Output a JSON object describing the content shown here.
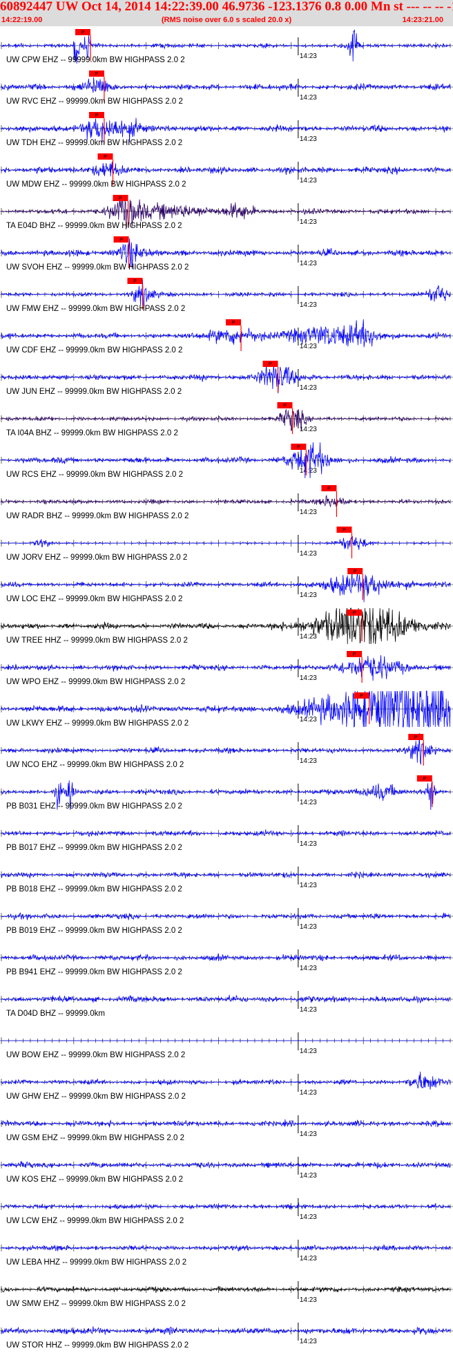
{
  "header": {
    "title": "60892447 UW Oct 14, 2014 14:22:39.00   46.9736 -123.1376  0.8 0.00 Mn st --- -- --   -1",
    "start_time": "14:22:19.00",
    "end_time": "14:23:21.00",
    "noise_note": "(RMS noise over 6.0 s scaled 20.0 x)"
  },
  "chart_data": {
    "type": "line",
    "x_unit": "seconds after 14:22:19.00",
    "xlim": [
      0,
      62
    ],
    "minute_tick_label": "14:23",
    "minute_tick_x": 41,
    "pick_label": "P",
    "colors": {
      "blue": "#0000ff",
      "purple": "#2a0066",
      "black": "#000000",
      "pick": "#ff0000"
    },
    "traces": [
      {
        "label": "UW CPW EHZ -- 99999.0km BW  HIGHPASS  2.0  2",
        "color": "blue",
        "amp": 0.35,
        "pick": 10.3,
        "events": [
          {
            "t": 10.4,
            "a": 4.2,
            "d": 0.3
          },
          {
            "t": 11.9,
            "a": 2.0,
            "d": 0.3
          },
          {
            "t": 48.6,
            "a": 3.6,
            "d": 0.4
          }
        ]
      },
      {
        "label": "UW RVC EHZ -- 99999.0km BW  HIGHPASS  2.0  2",
        "color": "blue",
        "amp": 0.5,
        "pick": 12.2,
        "events": [
          {
            "t": 13.0,
            "a": 1.5,
            "d": 1.2
          }
        ]
      },
      {
        "label": "UW TDH EHZ -- 99999.0km BW  HIGHPASS  2.0  2",
        "color": "blue",
        "amp": 0.55,
        "pick": 12.2,
        "events": [
          {
            "t": 13.8,
            "a": 1.6,
            "d": 2.0
          },
          {
            "t": 17.8,
            "a": 0.9,
            "d": 2.0
          }
        ]
      },
      {
        "label": "UW MDW EHZ -- 99999.0km BW  HIGHPASS  2.0  2",
        "color": "blue",
        "amp": 0.55,
        "pick": 13.4,
        "events": [
          {
            "t": 14.3,
            "a": 1.1,
            "d": 1.5
          }
        ]
      },
      {
        "label": "TA E04D BHZ -- 99999.0km BW  HIGHPASS  2.0  2",
        "color": "purple",
        "amp": 0.45,
        "pick": 15.5,
        "events": [
          {
            "t": 17.2,
            "a": 2.6,
            "d": 1.6
          },
          {
            "t": 24.0,
            "a": 1.1,
            "d": 3.0
          },
          {
            "t": 33.0,
            "a": 1.1,
            "d": 1.5
          }
        ]
      },
      {
        "label": "UW SVOH EHZ -- 99999.0km BW  HIGHPASS  2.0  2",
        "color": "blue",
        "amp": 0.55,
        "pick": 15.6,
        "events": [
          {
            "t": 17.7,
            "a": 2.2,
            "d": 1.0
          }
        ]
      },
      {
        "label": "UW FMW EHZ -- 99999.0km BW  HIGHPASS  2.0  2",
        "color": "blue",
        "amp": 0.35,
        "pick": 17.5,
        "events": [
          {
            "t": 19.6,
            "a": 1.8,
            "d": 1.0
          },
          {
            "t": 60.3,
            "a": 1.6,
            "d": 1.0
          }
        ]
      },
      {
        "label": "UW CDF EHZ -- 99999.0km BW  HIGHPASS  2.0  2",
        "color": "blue",
        "amp": 0.45,
        "pick": 31.1,
        "events": [
          {
            "t": 32.0,
            "a": 1.3,
            "d": 2.5
          },
          {
            "t": 44.0,
            "a": 1.6,
            "d": 3.0
          },
          {
            "t": 50.0,
            "a": 1.6,
            "d": 2.0
          }
        ]
      },
      {
        "label": "UW JUN EHZ -- 99999.0km BW  HIGHPASS  2.0  2",
        "color": "blue",
        "amp": 0.5,
        "pick": 36.2,
        "events": [
          {
            "t": 38.0,
            "a": 2.2,
            "d": 1.8
          }
        ]
      },
      {
        "label": "TA I04A BHZ -- 99999.0km BW  HIGHPASS  2.0  2",
        "color": "purple",
        "amp": 0.35,
        "pick": 38.2,
        "events": [
          {
            "t": 40.2,
            "a": 1.8,
            "d": 1.2
          }
        ]
      },
      {
        "label": "UW RCS EHZ -- 99999.0km BW  HIGHPASS  2.0  2",
        "color": "blue",
        "amp": 0.5,
        "pick": 40.1,
        "events": [
          {
            "t": 42.5,
            "a": 3.0,
            "d": 1.8
          }
        ]
      },
      {
        "label": "UW RADR BHZ -- 99999.0km BW  HIGHPASS  2.0  2",
        "color": "purple",
        "amp": 0.35,
        "pick": 44.3,
        "events": [
          {
            "t": 45.8,
            "a": 0.8,
            "d": 1.5
          }
        ]
      },
      {
        "label": "UW JORV EHZ -- 99999.0km BW  HIGHPASS  2.0  2",
        "color": "blue",
        "amp": 0.12,
        "pick": 46.4,
        "events": [
          {
            "t": 5.6,
            "a": 0.8,
            "d": 0.8
          },
          {
            "t": 48.5,
            "a": 1.4,
            "d": 1.5
          }
        ]
      },
      {
        "label": "UW LOC EHZ -- 99999.0km BW  HIGHPASS  2.0  2",
        "color": "blue",
        "amp": 0.4,
        "pick": 47.9,
        "events": [
          {
            "t": 49.5,
            "a": 1.8,
            "d": 3.5
          }
        ]
      },
      {
        "label": "UW TREE HHZ -- 99999.0km BW  HIGHPASS  2.0  2",
        "color": "black",
        "amp": 0.5,
        "pick": 47.8,
        "events": [
          {
            "t": 50.0,
            "a": 4.0,
            "d": 4.5
          }
        ]
      },
      {
        "label": "UW WPO EHZ -- 99999.0km BW  HIGHPASS  2.0  2",
        "color": "blue",
        "amp": 0.45,
        "pick": 47.8,
        "events": [
          {
            "t": 51.0,
            "a": 1.9,
            "d": 3.0
          }
        ]
      },
      {
        "label": "UW LKWY EHZ -- 99999.0km BW  HIGHPASS  2.0  2",
        "color": "blue",
        "amp": 0.6,
        "pick": 48.8,
        "events": [
          {
            "t": 52.5,
            "a": 4.2,
            "d": 6.0
          }
        ],
        "clip_from": 51.8
      },
      {
        "label": "UW NCO EHZ -- 99999.0km BW  HIGHPASS  2.0  2",
        "color": "blue",
        "amp": 0.45,
        "pick": 56.3,
        "events": [
          {
            "t": 58.0,
            "a": 2.0,
            "d": 1.0
          }
        ]
      },
      {
        "label": "PB B031 EHZ -- 99999.0km BW  HIGHPASS  2.0  2",
        "color": "blue",
        "amp": 0.45,
        "pick": 57.5,
        "events": [
          {
            "t": 7.9,
            "a": 2.4,
            "d": 0.3
          },
          {
            "t": 9.5,
            "a": 2.8,
            "d": 0.3
          },
          {
            "t": 52.3,
            "a": 1.3,
            "d": 1.5
          },
          {
            "t": 59.4,
            "a": 2.6,
            "d": 0.4
          }
        ]
      },
      {
        "label": "PB B017 EHZ -- 99999.0km BW  HIGHPASS  2.0  2",
        "color": "blue",
        "amp": 0.45,
        "events": []
      },
      {
        "label": "PB B018 EHZ -- 99999.0km BW  HIGHPASS  2.0  2",
        "color": "blue",
        "amp": 0.45,
        "events": []
      },
      {
        "label": "PB B019 EHZ -- 99999.0km BW  HIGHPASS  2.0  2",
        "color": "blue",
        "amp": 0.45,
        "events": []
      },
      {
        "label": "PB B941 EHZ -- 99999.0km BW  HIGHPASS  2.0  2",
        "color": "blue",
        "amp": 0.5,
        "events": []
      },
      {
        "label": "TA D04D BHZ -- 99999.0km",
        "color": "blue",
        "amp": 0.55,
        "events": []
      },
      {
        "label": "UW BOW EHZ -- 99999.0km BW  HIGHPASS  2.0  2",
        "color": "blue",
        "amp": 0.0,
        "events": []
      },
      {
        "label": "UW GHW EHZ -- 99999.0km BW  HIGHPASS  2.0  2",
        "color": "blue",
        "amp": 0.4,
        "events": [
          {
            "t": 58.5,
            "a": 1.4,
            "d": 1.5
          }
        ]
      },
      {
        "label": "UW GSM EHZ -- 99999.0km BW  HIGHPASS  2.0  2",
        "color": "blue",
        "amp": 0.5,
        "events": []
      },
      {
        "label": "UW KOS EHZ -- 99999.0km BW  HIGHPASS  2.0  2",
        "color": "blue",
        "amp": 0.5,
        "events": []
      },
      {
        "label": "UW LCW EHZ -- 99999.0km BW  HIGHPASS  2.0  2",
        "color": "blue",
        "amp": 0.4,
        "events": []
      },
      {
        "label": "UW LEBA HHZ -- 99999.0km BW  HIGHPASS  2.0  2",
        "color": "blue",
        "amp": 0.45,
        "events": []
      },
      {
        "label": "UW SMW EHZ -- 99999.0km BW  HIGHPASS  2.0  2",
        "color": "black",
        "amp": 0.45,
        "events": []
      },
      {
        "label": "UW STOR HHZ -- 99999.0km BW  HIGHPASS  2.0  2",
        "color": "blue",
        "amp": 0.6,
        "events": []
      },
      {
        "label": "",
        "color": "black",
        "amp": 0.5,
        "events": []
      }
    ]
  }
}
